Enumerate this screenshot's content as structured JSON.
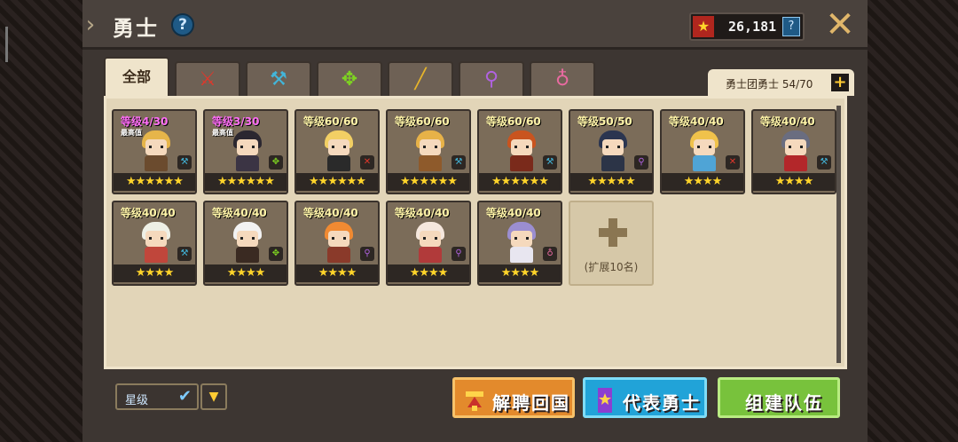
{
  "header": {
    "title": "勇士",
    "help_symbol": "?",
    "currency_value": "26,181",
    "currency_help": "?",
    "close_symbol": "✕"
  },
  "tabs": [
    {
      "label": "全部",
      "icon": "all",
      "color": "#3b2b1a",
      "glyph": ""
    },
    {
      "label": "",
      "icon": "sword-icon",
      "color": "#e0372b",
      "glyph": "⚔"
    },
    {
      "label": "",
      "icon": "hammer-icon",
      "color": "#42b5d9",
      "glyph": "⚒"
    },
    {
      "label": "",
      "icon": "bow-icon",
      "color": "#7ed321",
      "glyph": "✥"
    },
    {
      "label": "",
      "icon": "gun-icon",
      "color": "#e8b52a",
      "glyph": "╱"
    },
    {
      "label": "",
      "icon": "staff-icon",
      "color": "#b062e0",
      "glyph": "⚲"
    },
    {
      "label": "",
      "icon": "support-icon",
      "color": "#e86aa0",
      "glyph": "♁"
    }
  ],
  "roster": {
    "label": "勇士团勇士 54/70",
    "plus_symbol": "+"
  },
  "heroes": [
    {
      "level": "等级4/30",
      "tag": "最高值",
      "purple": true,
      "stars": "★★★★★★",
      "type_icon": "hammer-icon",
      "type_color": "#42b5d9",
      "type_glyph": "⚒",
      "hair": "#e6b54a",
      "body": "#6b4b2e"
    },
    {
      "level": "等级3/30",
      "tag": "最高值",
      "purple": true,
      "stars": "★★★★★★",
      "type_icon": "bow-icon",
      "type_color": "#7ed321",
      "type_glyph": "✥",
      "hair": "#2b2730",
      "body": "#3b3444"
    },
    {
      "level": "等级60/60",
      "tag": "",
      "purple": false,
      "stars": "★★★★★★",
      "type_icon": "sword-icon",
      "type_color": "#e0372b",
      "type_glyph": "✕",
      "hair": "#f2cf64",
      "body": "#2a2a2a"
    },
    {
      "level": "等级60/60",
      "tag": "",
      "purple": false,
      "stars": "★★★★★★",
      "type_icon": "hammer-icon",
      "type_color": "#42b5d9",
      "type_glyph": "⚒",
      "hair": "#e7b248",
      "body": "#8e5a2b"
    },
    {
      "level": "等级60/60",
      "tag": "",
      "purple": false,
      "stars": "★★★★★★",
      "type_icon": "hammer-icon",
      "type_color": "#42b5d9",
      "type_glyph": "⚒",
      "hair": "#c9541f",
      "body": "#7a2a1b"
    },
    {
      "level": "等级50/50",
      "tag": "",
      "purple": false,
      "stars": "★★★★★",
      "type_icon": "staff-icon",
      "type_color": "#b062e0",
      "type_glyph": "⚲",
      "hair": "#2b3550",
      "body": "#2c3447"
    },
    {
      "level": "等级40/40",
      "tag": "",
      "purple": false,
      "stars": "★★★★",
      "type_icon": "sword-icon",
      "type_color": "#e0372b",
      "type_glyph": "✕",
      "hair": "#f0c24b",
      "body": "#4fa4d6"
    },
    {
      "level": "等级40/40",
      "tag": "",
      "purple": false,
      "stars": "★★★★",
      "type_icon": "hammer-icon",
      "type_color": "#42b5d9",
      "type_glyph": "⚒",
      "hair": "#6a6d80",
      "body": "#b3272a"
    },
    {
      "level": "等级40/40",
      "tag": "",
      "purple": false,
      "stars": "★★★★",
      "type_icon": "hammer-icon",
      "type_color": "#42b5d9",
      "type_glyph": "⚒",
      "hair": "#eef0e6",
      "body": "#c0463b"
    },
    {
      "level": "等级40/40",
      "tag": "",
      "purple": false,
      "stars": "★★★★",
      "type_icon": "bow-icon",
      "type_color": "#7ed321",
      "type_glyph": "✥",
      "hair": "#f2f2f2",
      "body": "#3a2a22"
    },
    {
      "level": "等级40/40",
      "tag": "",
      "purple": false,
      "stars": "★★★★",
      "type_icon": "staff-icon",
      "type_color": "#b062e0",
      "type_glyph": "⚲",
      "hair": "#f08a32",
      "body": "#8a3a2a"
    },
    {
      "level": "等级40/40",
      "tag": "",
      "purple": false,
      "stars": "★★★★",
      "type_icon": "staff-icon",
      "type_color": "#b062e0",
      "type_glyph": "⚲",
      "hair": "#f5e7dd",
      "body": "#b13a3a"
    },
    {
      "level": "等级40/40",
      "tag": "",
      "purple": false,
      "stars": "★★★★",
      "type_icon": "support-icon",
      "type_color": "#e86aa0",
      "type_glyph": "♁",
      "hair": "#9b8ed1",
      "body": "#e8e6f0"
    }
  ],
  "expand": {
    "label": "(扩展10名)"
  },
  "footer": {
    "sort_label": "星级",
    "sort_check": "✔",
    "sort_dir_symbol": "▼",
    "dismiss_label": "解聘回国",
    "representative_label": "代表勇士",
    "team_label": "组建队伍"
  }
}
